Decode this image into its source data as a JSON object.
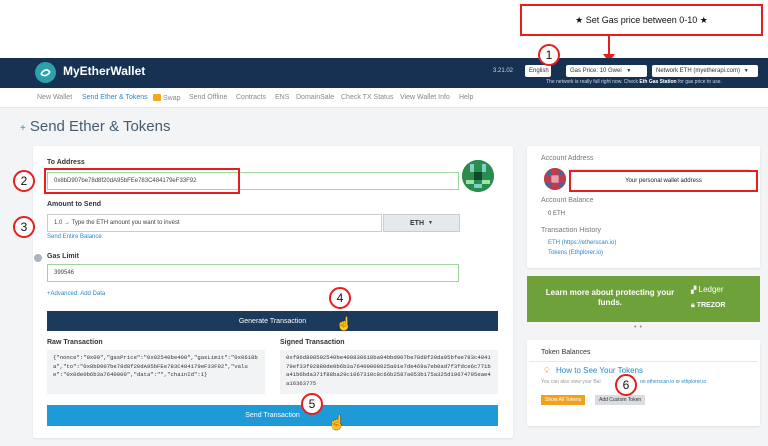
{
  "annotation": {
    "callout_text": "★ Set Gas price between 0-10 ★",
    "steps": [
      "1",
      "2",
      "3",
      "4",
      "5",
      "6"
    ]
  },
  "header": {
    "brand": "MyEtherWallet",
    "version": "3.21.02",
    "language": "English",
    "gas_price": "Gas Price: 10 Gwei",
    "network": "Network ETH (myetherapi.com)",
    "note_prefix": "The network is really full right now. Check",
    "note_link": "Eth Gas Station",
    "note_suffix": "for gas price to use."
  },
  "nav": {
    "items": [
      "New Wallet",
      "Send Ether & Tokens",
      "Swap",
      "Send Offline",
      "Contracts",
      "ENS",
      "DomainSale",
      "Check TX Status",
      "View Wallet Info",
      "Help"
    ],
    "active_index": 1
  },
  "page": {
    "title": "Send Ether & Tokens"
  },
  "form": {
    "to_label": "To Address",
    "to_value": "0x8bD907be78d8f20dA95bFEe783C484179eF33F92",
    "amount_label": "Amount to Send",
    "amount_value": "1.0  → Type the ETH amount you want to invest",
    "currency": "ETH",
    "send_entire": "Send Entire Balance",
    "gas_label": "Gas Limit",
    "gas_value": "399546",
    "advanced_link": "+Advanced: Add Data",
    "generate_button": "Generate Transaction",
    "raw_label": "Raw Transaction",
    "raw_value": "{\"nonce\":\"0x00\",\"gasPrice\":\"0x02540be400\",\"gasLimit\":\"0x0618ba\",\"to\":\"0x8bD907be78d8f20dA95bFEe783C484179eF33F92\",\"value\":\"0x0de0b6b3a7640000\",\"data\":\"\",\"chainId\":1}",
    "signed_label": "Signed Transaction",
    "signed_value": "0xf86d808502540be400830618ba94bbd907be78d8f20da95bfee783c484179ef33f92880de0b6b3a76400008025a01e7de469a7eb0ad7f3fdce6c771ba41b6bda371f88ba29c1067310c8c66b2587a053b175a325d19674705eae4a16363775",
    "send_button": "Send Transaction"
  },
  "account": {
    "address_label": "Account Address",
    "address_note": "Your personal wallet address",
    "balance_label": "Account Balance",
    "balance_value": "0 ETH",
    "history_label": "Transaction History",
    "history_etherscan": "ETH (https://etherscan.io)",
    "history_ethplorer": "Tokens (Ethplorer.io)"
  },
  "promo": {
    "text": "Learn more about protecting your funds.",
    "ledger": "Ledger",
    "trezor": "TREZOR"
  },
  "tokens": {
    "title": "Token Balances",
    "how_to": "How to See Your Tokens",
    "description_start": "You can also view your Bal",
    "description_end": "on etherscan.io or ethplorer.io",
    "show_all": "Show All Tokens",
    "add_custom": "Add Custom Token"
  },
  "colors": {
    "header_bg": "#163151",
    "accent": "#2a88c6",
    "promo_green": "#6ea13a",
    "annotation_red": "#e61e1e",
    "show_all_orange": "#f0a21e"
  }
}
